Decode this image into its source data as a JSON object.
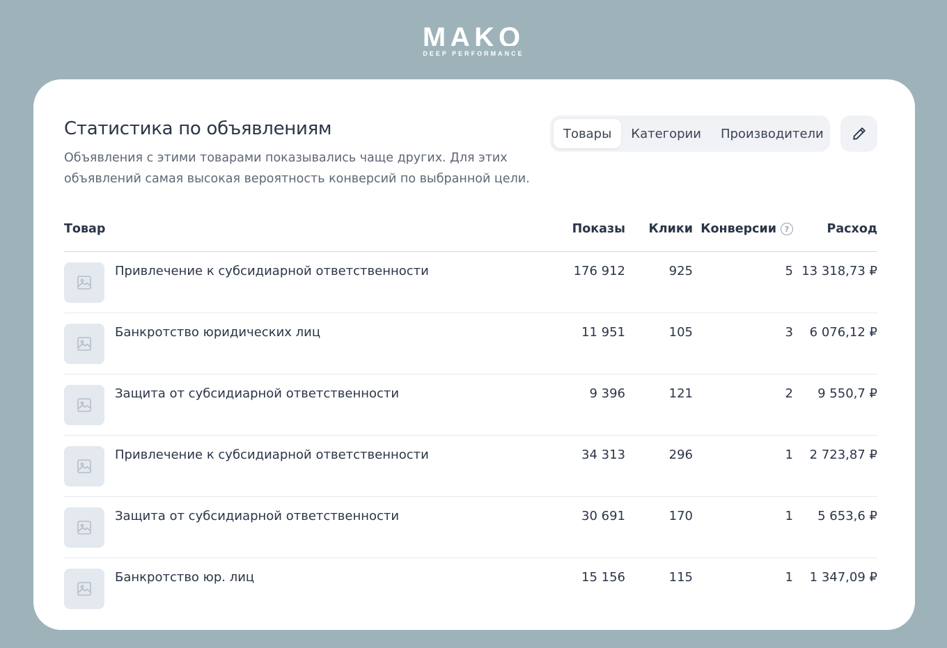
{
  "logo": {
    "word": "MAKO",
    "tagline": "DEEP PERFORMANCE"
  },
  "card": {
    "title": "Статистика по объявлениям",
    "subtitle_line1": "Объявления с этими товарами показывались чаще других. Для этих",
    "subtitle_line2": "объявлений самая высокая вероятность конверсий по выбранной цели."
  },
  "tabs": [
    {
      "label": "Товары",
      "active": true
    },
    {
      "label": "Категории",
      "active": false
    },
    {
      "label": "Производители",
      "active": false
    }
  ],
  "edit_button": {
    "icon": "pencil-icon"
  },
  "table": {
    "headers": {
      "product": "Товар",
      "shows": "Показы",
      "clicks": "Клики",
      "conversions": "Конверсии",
      "cost": "Расход"
    },
    "help_icon": "question-circle-icon",
    "rows": [
      {
        "name": "Привлечение к субсидиарной ответственности",
        "shows": "176 912",
        "clicks": "925",
        "conversions": "5",
        "cost": "13 318,73 ₽"
      },
      {
        "name": "Банкротство юридических лиц",
        "shows": "11 951",
        "clicks": "105",
        "conversions": "3",
        "cost": "6 076,12 ₽"
      },
      {
        "name": "Защита от субсидиарной ответственности",
        "shows": "9 396",
        "clicks": "121",
        "conversions": "2",
        "cost": "9 550,7 ₽"
      },
      {
        "name": "Привлечение к субсидиарной ответственности",
        "shows": "34 313",
        "clicks": "296",
        "conversions": "1",
        "cost": "2 723,87 ₽"
      },
      {
        "name": "Защита от субсидиарной ответственности",
        "shows": "30 691",
        "clicks": "170",
        "conversions": "1",
        "cost": "5 653,6 ₽"
      },
      {
        "name": "Банкротство юр. лиц",
        "shows": "15 156",
        "clicks": "115",
        "conversions": "1",
        "cost": "1 347,09 ₽"
      }
    ]
  },
  "colors": {
    "background": "#9db3b9",
    "card": "#ffffff",
    "tab_bg": "#f0f2f6",
    "text": "#2b3548",
    "muted": "#5f6776"
  }
}
